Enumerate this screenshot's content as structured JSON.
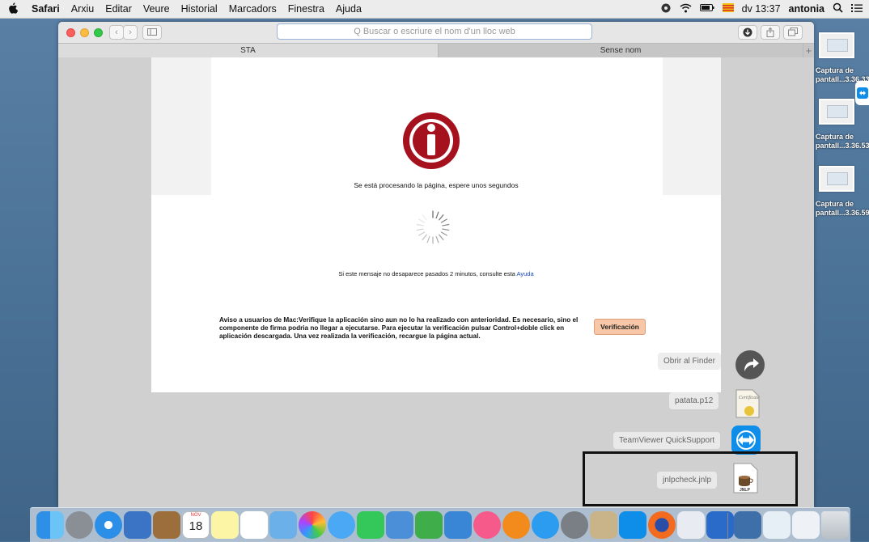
{
  "menubar": {
    "app_name": "Safari",
    "items": [
      "Arxiu",
      "Editar",
      "Veure",
      "Historial",
      "Marcadors",
      "Finestra",
      "Ajuda"
    ],
    "clock": "dv 13:37",
    "user": "antonia"
  },
  "browser": {
    "address_placeholder": "Q Buscar o escriure el nom d'un lloc web",
    "tabs": [
      {
        "label": "STA"
      },
      {
        "label": "Sense nom"
      }
    ],
    "new_tab": "+"
  },
  "page": {
    "processing_message": "Se está procesando la página, espere unos segundos",
    "help_prefix": "Si este mensaje no desaparece pasados 2 minutos, consulte esta ",
    "help_link": "Ayuda",
    "mac_notice": "Aviso a usuarios de Mac:Verifique la aplicación sino aun no lo ha realizado con anterioridad. Es necesario, sino el componente de firma podria no llegar a ejecutarse. Para ejecutar la verificación pulsar Control+doble click en aplicación descargada. Una vez realizada la verificación, recargue la página actual.",
    "verify_button": "Verificación"
  },
  "desktop_files": [
    {
      "line1": "Captura de",
      "line2": "pantall...3.36.33"
    },
    {
      "line1": "Captura de",
      "line2": "pantall...3.36.53"
    },
    {
      "line1": "Captura de",
      "line2": "pantall...3.36.59"
    }
  ],
  "downloads_stack": {
    "open_in_finder": "Obrir al Finder",
    "items": [
      "patata.p12",
      "TeamViewer QuickSupport",
      "jnlpcheck.jnlp"
    ],
    "calendar_month": "NOV",
    "calendar_day": "18"
  },
  "colors": {
    "info_red": "#a5121e",
    "verify_bg": "#f7c7a7",
    "highlight_border": "#111111"
  }
}
